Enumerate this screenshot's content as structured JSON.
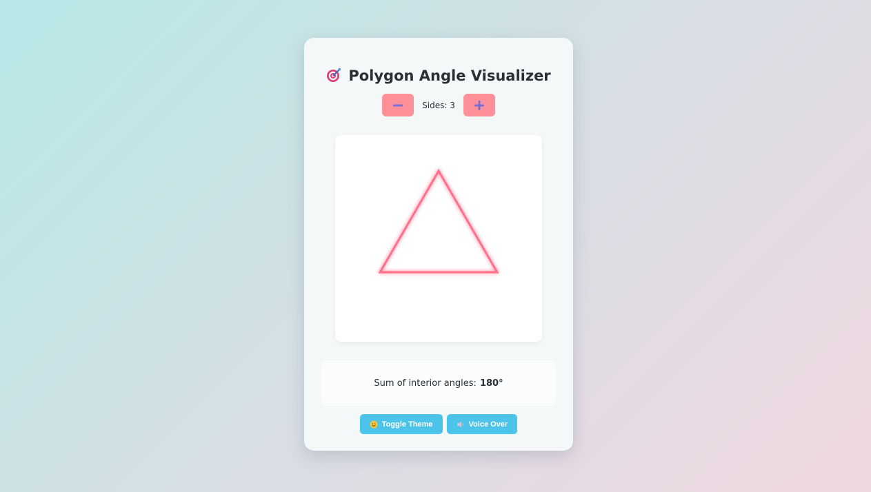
{
  "app": {
    "title": "Polygon Angle Visualizer",
    "title_icon": "dart-target-icon"
  },
  "controls": {
    "decrease_icon": "minus-icon",
    "increase_icon": "plus-icon",
    "sides_text": "Sides: 3",
    "sides": 3
  },
  "polygon": {
    "sides": 3,
    "stroke_color": "#ff6f8a",
    "glow_color": "#ff9fb0"
  },
  "info": {
    "label": "Sum of interior angles:",
    "value": "180°"
  },
  "actions": {
    "theme_label": "Toggle Theme",
    "theme_icon": "smiley-face-icon",
    "voice_label": "Voice Over",
    "voice_icon": "speaker-icon"
  },
  "colors": {
    "control_button": "#ff8f99",
    "control_icon": "#7a6fd8",
    "action_button": "#4cc4e9",
    "text": "#2a2f36"
  }
}
